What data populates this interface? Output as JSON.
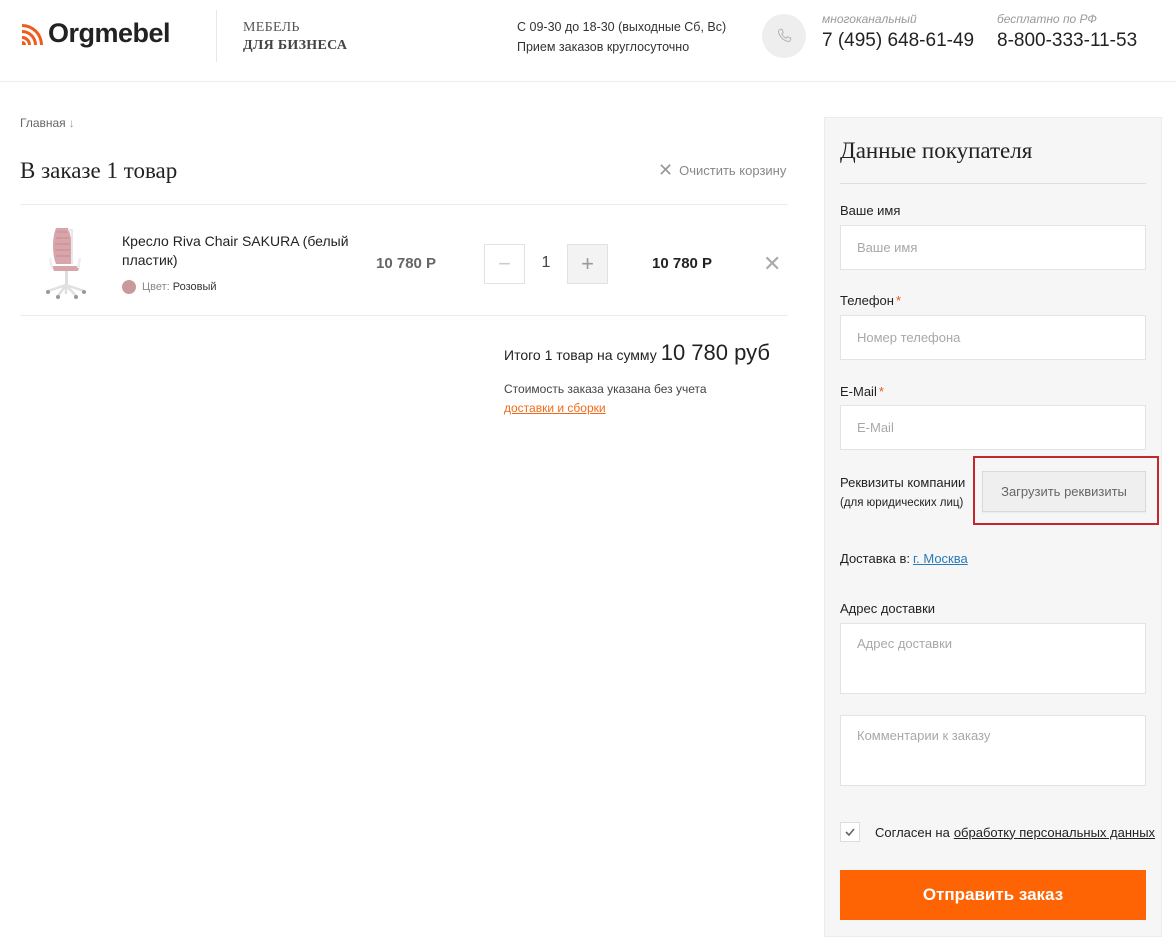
{
  "header": {
    "logo_text": "Orgmebel",
    "tagline_line1": "МЕБЕЛЬ",
    "tagline_line2": "ДЛЯ БИЗНЕСА",
    "hours_line1": "С 09-30 до 18-30 (выходные Сб, Вс)",
    "hours_line2": "Прием заказов круглосуточно",
    "phone1_caption": "многоканальный",
    "phone1_number": "7 (495) 648-61-49",
    "phone2_caption": "бесплатно по РФ",
    "phone2_number": "8-800-333-11-53",
    "accent_color": "#f05a1a"
  },
  "breadcrumb": {
    "home": "Главная",
    "arrow": "↓"
  },
  "cart": {
    "title": "В заказе 1 товар",
    "clear_label": "Очистить корзину",
    "items": [
      {
        "name": "Кресло Riva Chair SAKURA (белый пластик)",
        "color_label": "Цвет:",
        "color_value": "Розовый",
        "color_hex": "#c99a9a",
        "price": "10 780 Р",
        "minus": "−",
        "quantity": "1",
        "plus": "+",
        "total": "10 780 Р",
        "remove": "✕"
      }
    ],
    "summary_label": "Итого 1 товар на сумму",
    "summary_value": "10 780 руб",
    "note_text": "Стоимость заказа указана без учета",
    "note_link": "доставки и сборки"
  },
  "buyer": {
    "title": "Данные покупателя",
    "name_label": "Ваше имя",
    "name_placeholder": "Ваше имя",
    "phone_label": "Телефон",
    "phone_placeholder": "Номер телефона",
    "email_label": "E-Mail",
    "email_placeholder": "E-Mail",
    "required_mark": "*",
    "requisites_label": "Реквизиты компании",
    "requisites_sub": "(для юридических лиц)",
    "upload_label": "Загрузить реквизиты",
    "delivery_label": "Доставка в:",
    "delivery_city": "г. Москва",
    "address_label": "Адрес доставки",
    "address_placeholder": "Адрес доставки",
    "comment_placeholder": "Комментарии к заказу",
    "agree_text": "Согласен на",
    "agree_link": "обработку персональных данных",
    "agree_checked": true,
    "submit_label": "Отправить заказ",
    "submit_color": "#ff6404"
  }
}
